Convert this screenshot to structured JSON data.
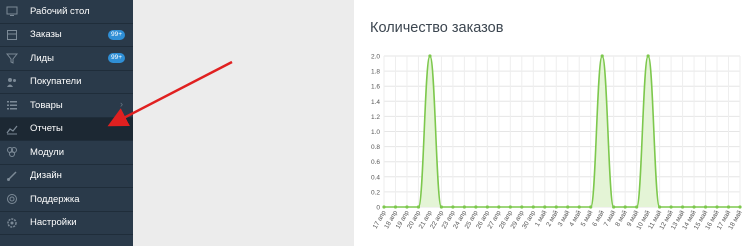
{
  "sidebar": {
    "items": [
      {
        "label": "Рабочий стол",
        "icon": "desktop-icon"
      },
      {
        "label": "Заказы",
        "icon": "box-icon",
        "badge": "99+"
      },
      {
        "label": "Лиды",
        "icon": "funnel-icon",
        "badge": "99+"
      },
      {
        "label": "Покупатели",
        "icon": "users-icon"
      },
      {
        "label": "Товары",
        "icon": "list-icon",
        "chevron": "›"
      },
      {
        "label": "Отчеты",
        "icon": "chart-icon",
        "active": true
      },
      {
        "label": "Модули",
        "icon": "modules-icon"
      },
      {
        "label": "Дизайн",
        "icon": "brush-icon"
      },
      {
        "label": "Поддержка",
        "icon": "support-icon"
      },
      {
        "label": "Настройки",
        "icon": "gear-icon"
      }
    ]
  },
  "colors": {
    "sidebar_bg": "#2a3a4a",
    "active_bg": "#1c2833",
    "badge": "#2f8fd6",
    "series_line": "#7dc84d",
    "series_fill": "#e4f4d6",
    "arrow": "#e02020"
  },
  "panel": {
    "title": "Количество заказов"
  },
  "chart_data": {
    "type": "area",
    "categories": [
      "17 апр",
      "18 апр",
      "19 апр",
      "20 апр",
      "21 апр",
      "22 апр",
      "23 апр",
      "24 апр",
      "25 апр",
      "26 апр",
      "27 апр",
      "28 апр",
      "29 апр",
      "30 апр",
      "1 май",
      "2 май",
      "3 май",
      "4 май",
      "5 май",
      "6 май",
      "7 май",
      "8 май",
      "9 май",
      "10 май",
      "11 май",
      "12 май",
      "13 май",
      "14 май",
      "15 май",
      "16 май",
      "17 май",
      "18 май"
    ],
    "values": [
      0,
      0,
      0,
      0,
      2,
      0,
      0,
      0,
      0,
      0,
      0,
      0,
      0,
      0,
      0,
      0,
      0,
      0,
      0,
      2,
      0,
      0,
      0,
      2,
      0,
      0,
      0,
      0,
      0,
      0,
      0,
      0
    ],
    "yticks": [
      "0",
      "0.2",
      "0.4",
      "0.6",
      "0.8",
      "1.0",
      "1.2",
      "1.4",
      "1.6",
      "1.8",
      "2.0"
    ],
    "ylim": [
      0,
      2
    ],
    "grid": true
  }
}
